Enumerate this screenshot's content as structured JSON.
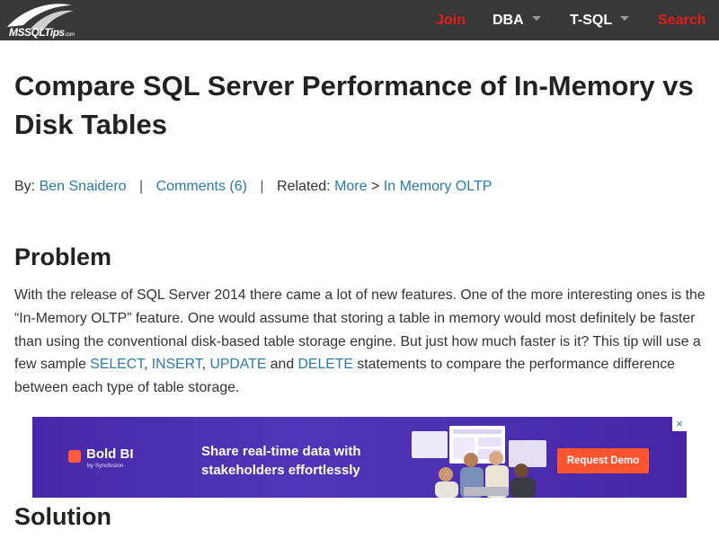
{
  "header": {
    "logo_text": "MSSQLTips",
    "logo_suffix": ".com",
    "nav": {
      "join": "Join",
      "dba": "DBA",
      "tsql": "T-SQL",
      "search": "Search"
    }
  },
  "article": {
    "title": "Compare SQL Server Performance of In-Memory vs Disk Tables",
    "byline": {
      "by_label": "By:",
      "author": "Ben Snaidero",
      "separator": "|",
      "comments": "Comments (6)",
      "related_label": "Related:",
      "related_more": "More",
      "related_arrow": ">",
      "related_topic": "In Memory OLTP"
    },
    "problem_heading": "Problem",
    "problem_text": {
      "part1": "With the release of SQL Server 2014 there came a lot of new features. One of the more interesting ones is the “In-Memory OLTP” feature. One would assume that storing a table in memory would most definitely be faster than using the conventional disk-based table storage engine. But just how much faster is it? This tip will use a few sample ",
      "link_select": "SELECT",
      "comma1": ", ",
      "link_insert": "INSERT",
      "comma2": ", ",
      "link_update": "UPDATE",
      "and": " and ",
      "link_delete": "DELETE",
      "part2": " statements to compare the performance difference between each type of table storage."
    },
    "solution_heading": "Solution"
  },
  "ad": {
    "brand_name": "Bold BI",
    "brand_by": "by Syncfusion",
    "headline": "Share real-time data with stakeholders effortlessly",
    "cta": "Request Demo",
    "close": "×"
  },
  "colors": {
    "nav_bg": "#383838",
    "nav_accent": "#e41b17",
    "link": "#2a7ab0",
    "ad_bg": "#4a2fae",
    "ad_cta": "#ff5430"
  }
}
